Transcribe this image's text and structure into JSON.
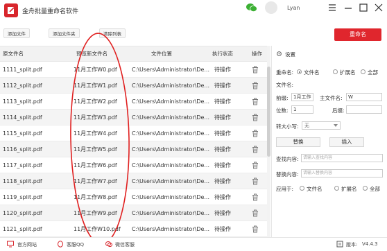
{
  "app": {
    "title": "金舟批量重命名软件",
    "username": "Lyan"
  },
  "toolbar": {
    "add_file": "添加文件",
    "add_folder": "添加文件夹",
    "clear_list": "清除列表",
    "rename": "重命名"
  },
  "table": {
    "headers": [
      "原文件名",
      "预览新文件名",
      "文件位置",
      "执行状态",
      "操作"
    ],
    "rows": [
      {
        "orig": "1111_split.pdf",
        "preview": "11月工作W0.pdf",
        "location": "C:\\Users\\Administrator\\De...",
        "status": "待操作"
      },
      {
        "orig": "1112_split.pdf",
        "preview": "11月工作W1.pdf",
        "location": "C:\\Users\\Administrator\\De...",
        "status": "待操作"
      },
      {
        "orig": "1113_split.pdf",
        "preview": "11月工作W2.pdf",
        "location": "C:\\Users\\Administrator\\De...",
        "status": "待操作"
      },
      {
        "orig": "1114_split.pdf",
        "preview": "11月工作W3.pdf",
        "location": "C:\\Users\\Administrator\\De...",
        "status": "待操作"
      },
      {
        "orig": "1115_split.pdf",
        "preview": "11月工作W4.pdf",
        "location": "C:\\Users\\Administrator\\De...",
        "status": "待操作"
      },
      {
        "orig": "1116_split.pdf",
        "preview": "11月工作W5.pdf",
        "location": "C:\\Users\\Administrator\\De...",
        "status": "待操作"
      },
      {
        "orig": "1117_split.pdf",
        "preview": "11月工作W6.pdf",
        "location": "C:\\Users\\Administrator\\De...",
        "status": "待操作"
      },
      {
        "orig": "1118_split.pdf",
        "preview": "11月工作W7.pdf",
        "location": "C:\\Users\\Administrator\\De...",
        "status": "待操作"
      },
      {
        "orig": "1119_split.pdf",
        "preview": "11月工作W8.pdf",
        "location": "C:\\Users\\Administrator\\De...",
        "status": "待操作"
      },
      {
        "orig": "1120_split.pdf",
        "preview": "11月工作W9.pdf",
        "location": "C:\\Users\\Administrator\\De...",
        "status": "待操作"
      },
      {
        "orig": "1121_split.pdf",
        "preview": "11月工作W10.pdf",
        "location": "C:\\Users\\Administrator\\De...",
        "status": "待操作"
      }
    ]
  },
  "settings": {
    "title": "设置",
    "rename_label": "重命名:",
    "opt_filename": "文件名",
    "opt_ext": "扩展名",
    "opt_all": "全部",
    "filename_label": "文件名:",
    "prefix_label": "前缀:",
    "prefix_value": "1月工作",
    "main_label": "主文件名:",
    "main_value": "W",
    "digits_label": "位数:",
    "digits_value": "1",
    "suffix_label": "后缀:",
    "suffix_value": "",
    "case_label": "转大小写:",
    "case_value": "无",
    "replace_button": "替换",
    "insert_button": "插入",
    "find_label": "查找内容:",
    "find_placeholder": "请输入查找内容",
    "replace_label": "替换内容:",
    "replace_placeholder": "请输入替换内容",
    "apply_label": "应用于:",
    "apply_filename": "文件名",
    "apply_ext": "扩展名",
    "apply_all": "全部"
  },
  "statusbar": {
    "website": "官方网站",
    "qq": "客服QQ",
    "wechat": "微信客服",
    "version_label": "版本:",
    "version": "V4.4.3"
  },
  "colors": {
    "accent": "#e0262d",
    "annotation": "#e02020"
  }
}
